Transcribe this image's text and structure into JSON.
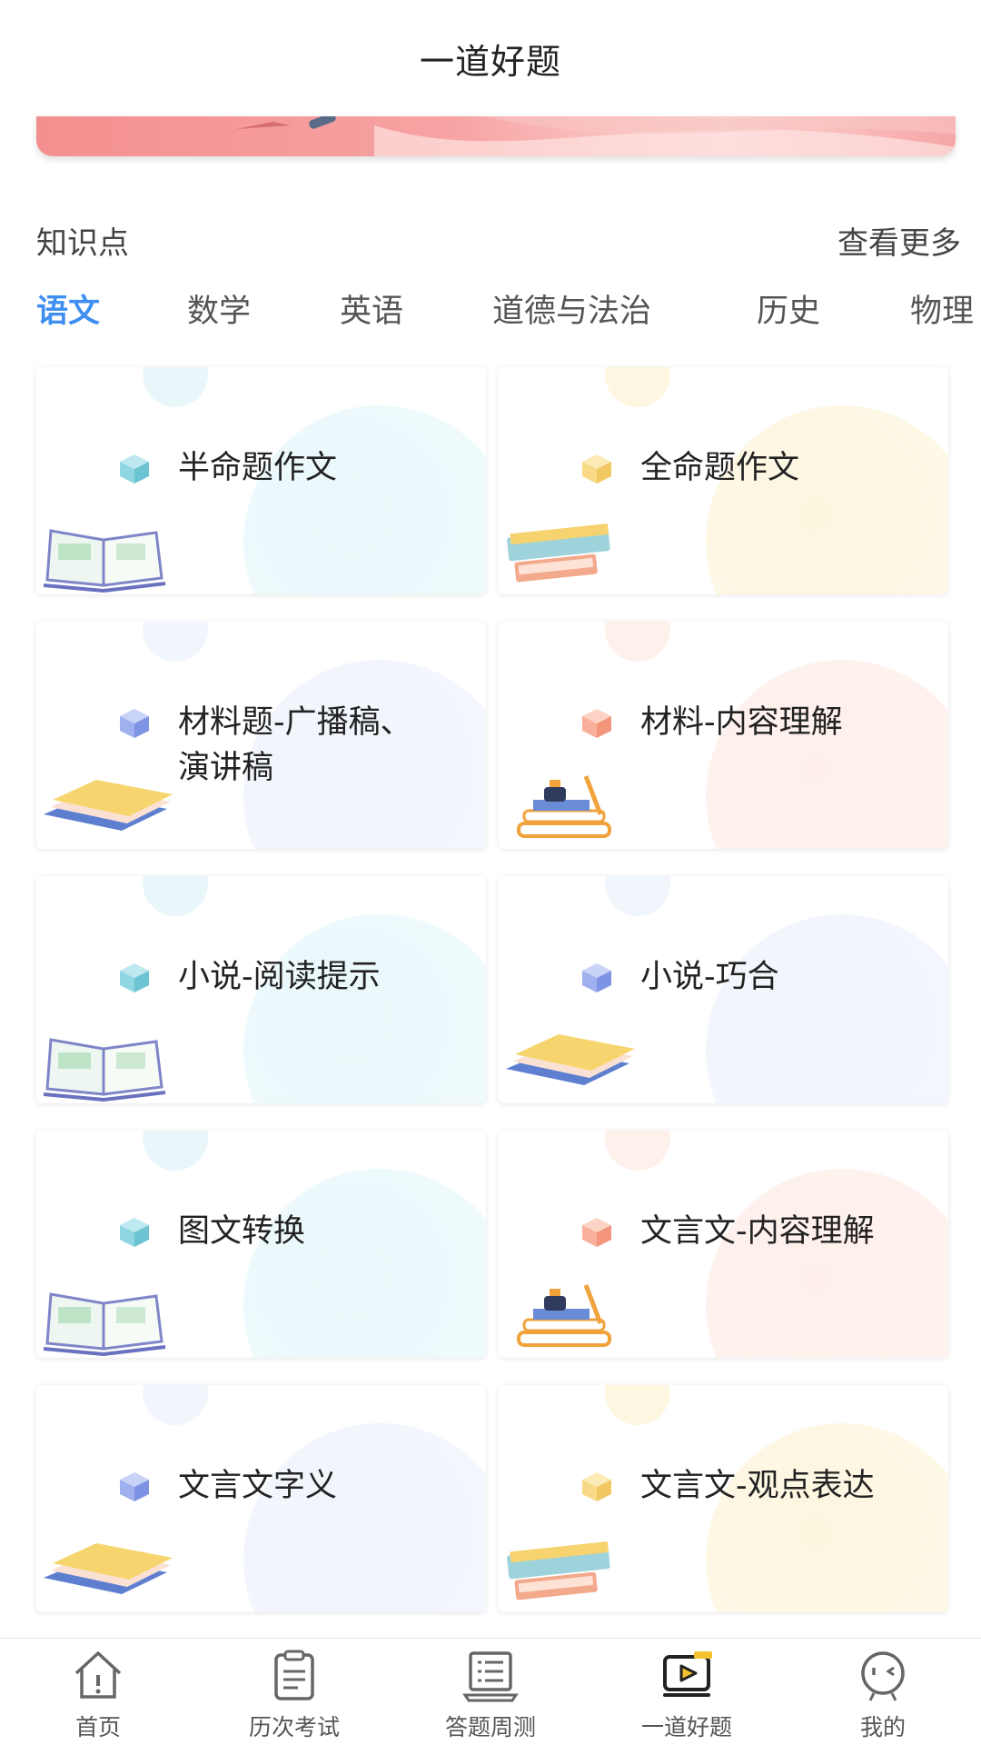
{
  "header": {
    "title": "一道好题"
  },
  "section": {
    "label": "知识点",
    "more": "查看更多"
  },
  "tabs": [
    {
      "label": "语文",
      "active": true
    },
    {
      "label": "数学",
      "active": false
    },
    {
      "label": "英语",
      "active": false
    },
    {
      "label": "道德与法治",
      "active": false
    },
    {
      "label": "历史",
      "active": false
    },
    {
      "label": "物理",
      "active": false
    }
  ],
  "cards": [
    {
      "name": "半命题作文",
      "theme": "cyan",
      "deco_icon": "open-book-icon"
    },
    {
      "name": "全命题作文",
      "theme": "yellow",
      "deco_icon": "book-stack-icon"
    },
    {
      "name": "材料题-广播稿、演讲稿",
      "theme": "blue",
      "deco_icon": "books-icon"
    },
    {
      "name": "材料-内容理解",
      "theme": "peach",
      "deco_icon": "books-pencil-icon"
    },
    {
      "name": "小说-阅读提示",
      "theme": "cyan",
      "deco_icon": "open-book-icon"
    },
    {
      "name": "小说-巧合",
      "theme": "blue",
      "deco_icon": "books-icon"
    },
    {
      "name": "图文转换",
      "theme": "cyan",
      "deco_icon": "open-book-icon"
    },
    {
      "name": "文言文-内容理解",
      "theme": "peach",
      "deco_icon": "books-pencil-icon"
    },
    {
      "name": "文言文字义",
      "theme": "blue",
      "deco_icon": "books-icon"
    },
    {
      "name": "文言文-观点表达",
      "theme": "yellow",
      "deco_icon": "book-stack-icon"
    }
  ],
  "tabbar": [
    {
      "label": "首页",
      "icon": "home-icon",
      "active": false
    },
    {
      "label": "历次考试",
      "icon": "clipboard-icon",
      "active": false
    },
    {
      "label": "答题周测",
      "icon": "laptop-checklist-icon",
      "active": false
    },
    {
      "label": "一道好题",
      "icon": "video-play-icon",
      "active": true
    },
    {
      "label": "我的",
      "icon": "profile-face-icon",
      "active": false
    }
  ],
  "colors": {
    "accent": "#3f8ff0",
    "cube_cyan": "#7fd0dc",
    "cube_yellow": "#f7d67a",
    "cube_blue": "#8fa4ec",
    "cube_peach": "#f6a58a"
  }
}
